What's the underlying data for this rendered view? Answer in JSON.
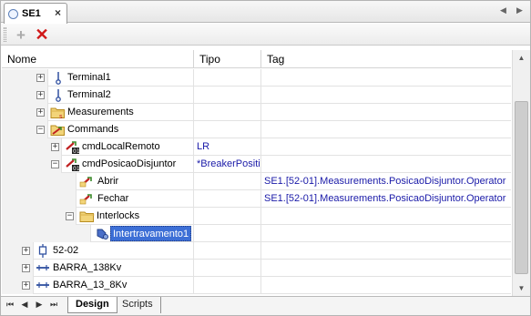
{
  "document_tab": {
    "label": "SE1",
    "close": "×"
  },
  "tab_nav": {
    "prev": "◀",
    "next": "▶"
  },
  "toolbar": {
    "add": "+",
    "delete": "✕"
  },
  "columns": {
    "nome": "Nome",
    "tipo": "Tipo",
    "tag": "Tag"
  },
  "rows": [
    {
      "label": "Terminal1",
      "tipo": "",
      "tag": "",
      "expander": "+",
      "icon": "terminal-icon"
    },
    {
      "label": "Terminal2",
      "tipo": "",
      "tag": "",
      "expander": "+",
      "icon": "terminal-icon"
    },
    {
      "label": "Measurements",
      "tipo": "",
      "tag": "",
      "expander": "+",
      "icon": "measurements-folder-icon"
    },
    {
      "label": "Commands",
      "tipo": "",
      "tag": "",
      "expander": "−",
      "icon": "commands-folder-icon"
    },
    {
      "label": "cmdLocalRemoto",
      "tipo": "LR",
      "tag": "",
      "expander": "+",
      "icon": "command-icon"
    },
    {
      "label": "cmdPosicaoDisjuntor",
      "tipo": "*BreakerPositi",
      "tag": "",
      "expander": "−",
      "icon": "command-icon"
    },
    {
      "label": "Abrir",
      "tipo": "",
      "tag": "SE1.[52-01].Measurements.PosicaoDisjuntor.Operator",
      "expander": "",
      "icon": "command-value-icon"
    },
    {
      "label": "Fechar",
      "tipo": "",
      "tag": "SE1.[52-01].Measurements.PosicaoDisjuntor.Operator",
      "expander": "",
      "icon": "command-value-icon"
    },
    {
      "label": "Interlocks",
      "tipo": "",
      "tag": "",
      "expander": "−",
      "icon": "interlocks-folder-icon"
    },
    {
      "label": "Intertravamento1",
      "tipo": "",
      "tag": "",
      "expander": "",
      "icon": "interlock-icon"
    },
    {
      "label": "52-02",
      "tipo": "",
      "tag": "",
      "expander": "+",
      "icon": "breaker-icon"
    },
    {
      "label": "BARRA_138Kv",
      "tipo": "",
      "tag": "",
      "expander": "+",
      "icon": "busbar-icon"
    },
    {
      "label": "BARRA_13_8Kv",
      "tipo": "",
      "tag": "",
      "expander": "+",
      "icon": "busbar-icon"
    }
  ],
  "bottom_tabs": {
    "design": "Design",
    "scripts": "Scripts"
  },
  "bottom_nav": {
    "first": "⏮",
    "prev": "◀",
    "next": "▶",
    "last": "⏭"
  },
  "scrollbar": {
    "up": "▲",
    "down": "▼"
  },
  "colors": {
    "selection": "#3d6fd6",
    "link_text": "#1a1aa8",
    "delete": "#d01818"
  }
}
